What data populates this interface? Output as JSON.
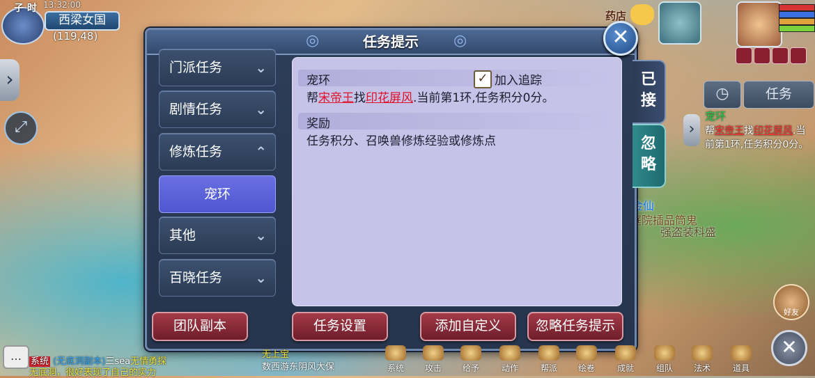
{
  "hud": {
    "time_label": "子 时",
    "time_value": "13:32:00",
    "city": "西梁女国",
    "coords": "(119,48)",
    "shop_label": "药店",
    "task_button": "任务",
    "track_title": "宠环",
    "track_line_prefix": "帮",
    "track_npc": "宋帝王",
    "track_mid": "找",
    "track_item": "印花屏风",
    "track_suffix": ".当前第1环,任务积分0分。",
    "friend_label": "好友"
  },
  "scene": {
    "text1": "金仙",
    "text2": "庭院插品筒鬼",
    "text3": "强盗装科盛"
  },
  "dialog": {
    "title": "任务提示",
    "categories": [
      {
        "label": "门派任务",
        "chevron": "down"
      },
      {
        "label": "剧情任务",
        "chevron": "down"
      },
      {
        "label": "修炼任务",
        "chevron": "up"
      },
      {
        "label": "其他",
        "chevron": "down"
      },
      {
        "label": "百晓任务",
        "chevron": "down"
      }
    ],
    "selected_sub": "宠环",
    "detail": {
      "task_title": "宠环",
      "track_checkbox_label": "加入追踪",
      "track_checked": true,
      "line_prefix": "帮",
      "npc": "宋帝王",
      "mid": "找",
      "item": "印花屏风",
      "suffix": ".当前第1环,任务积分0分。",
      "reward_title": "奖励",
      "reward_text": "任务积分、召唤兽修炼经验或修炼点"
    },
    "buttons": {
      "team_dungeon": "团队副本",
      "task_settings": "任务设置",
      "add_custom": "添加自定义",
      "ignore_tips": "忽略任务提示"
    },
    "tabs": {
      "accepted_1": "已",
      "accepted_2": "接",
      "ignore_1": "忽",
      "ignore_2": "略"
    }
  },
  "bottom_bar": [
    "系统",
    "攻击",
    "给予",
    "动作",
    "帮派",
    "绘卷",
    "成就",
    "组队",
    "法术",
    "道具"
  ],
  "chat": {
    "tag": "系统",
    "line1_blue": "(无底洞副本)",
    "line1_user": "三sea",
    "line1_yel": "无情勇探",
    "line2": "无底洞，很好表现了自己的实力",
    "line3": "无上宝",
    "line4": "数西游东阴风大保"
  }
}
